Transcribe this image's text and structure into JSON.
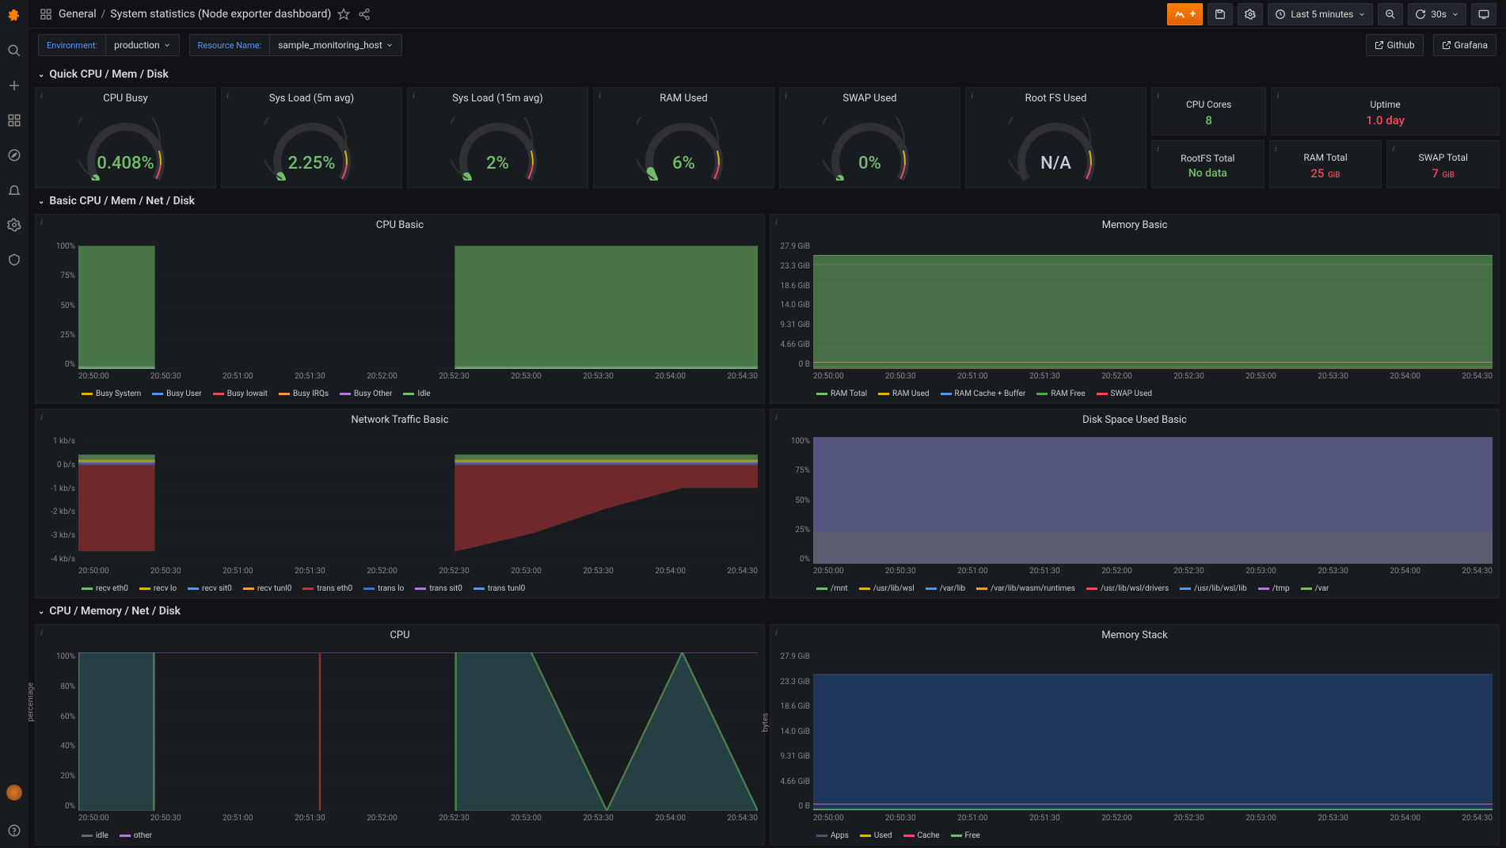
{
  "breadcrumb": {
    "icon": "dashboard-icon",
    "folder": "General",
    "title": "System statistics (Node exporter dashboard)"
  },
  "topbar": {
    "timerange": "Last 5 minutes",
    "refresh": "30s"
  },
  "vars": {
    "env_label": "Environment:",
    "env_value": "production",
    "res_label": "Resource Name:",
    "res_value": "sample_monitoring_host"
  },
  "links": {
    "github": "Github",
    "grafana": "Grafana"
  },
  "rows": {
    "quick": "Quick CPU / Mem / Disk",
    "basic": "Basic CPU / Mem / Net / Disk",
    "full": "CPU / Memory / Net / Disk"
  },
  "gauges": [
    {
      "title": "CPU Busy",
      "value": "0.408%",
      "pct": 0.4
    },
    {
      "title": "Sys Load (5m avg)",
      "value": "2.25%",
      "pct": 2.25
    },
    {
      "title": "Sys Load (15m avg)",
      "value": "2%",
      "pct": 2
    },
    {
      "title": "RAM Used",
      "value": "6%",
      "pct": 6
    },
    {
      "title": "SWAP Used",
      "value": "0%",
      "pct": 0
    },
    {
      "title": "Root FS Used",
      "value": "N/A",
      "pct": null
    }
  ],
  "stats_top": [
    {
      "title": "CPU Cores",
      "value": "8",
      "cls": "green"
    },
    {
      "title": "Uptime",
      "value": "1.0 day",
      "cls": "red"
    }
  ],
  "stats_bot": [
    {
      "title": "RootFS Total",
      "value": "No data",
      "cls": "nodata"
    },
    {
      "title": "RAM Total",
      "value": "25",
      "unit": "GiB",
      "cls": "red"
    },
    {
      "title": "SWAP Total",
      "value": "7",
      "unit": "GiB",
      "cls": "red"
    }
  ],
  "chart_data": [
    {
      "id": "cpu_basic",
      "title": "CPU Basic",
      "type": "area",
      "ylabel": "",
      "ylim": [
        0,
        100
      ],
      "yticks": [
        "0%",
        "25%",
        "50%",
        "75%",
        "100%"
      ],
      "x": [
        "20:50:00",
        "20:50:30",
        "20:51:00",
        "20:51:30",
        "20:52:00",
        "20:52:30",
        "20:53:00",
        "20:53:30",
        "20:54:00",
        "20:54:30"
      ],
      "series": [
        {
          "name": "Busy System",
          "color": "#e0b400",
          "values": [
            1,
            1,
            null,
            null,
            null,
            1,
            1,
            1,
            1,
            1
          ]
        },
        {
          "name": "Busy User",
          "color": "#5794f2",
          "values": [
            2,
            2,
            null,
            null,
            null,
            2,
            2,
            2,
            2,
            2
          ]
        },
        {
          "name": "Busy Iowait",
          "color": "#f2495c",
          "values": [
            0,
            0,
            null,
            null,
            null,
            0,
            0,
            0,
            0,
            0
          ]
        },
        {
          "name": "Busy IRQs",
          "color": "#ff9830",
          "values": [
            0,
            0,
            null,
            null,
            null,
            0,
            0,
            0,
            0,
            0
          ]
        },
        {
          "name": "Busy Other",
          "color": "#b877d9",
          "values": [
            0,
            0,
            null,
            null,
            null,
            0,
            0,
            0,
            0,
            0
          ]
        },
        {
          "name": "Idle",
          "color": "#73bf69",
          "values": [
            97,
            97,
            null,
            null,
            null,
            97,
            97,
            97,
            97,
            97
          ]
        }
      ],
      "stacked": true
    },
    {
      "id": "memory_basic",
      "title": "Memory Basic",
      "type": "area",
      "ylim": [
        0,
        27.9
      ],
      "yticks": [
        "0 B",
        "4.66 GiB",
        "9.31 GiB",
        "14.0 GiB",
        "18.6 GiB",
        "23.3 GiB",
        "27.9 GiB"
      ],
      "x": [
        "20:50:00",
        "20:50:30",
        "20:51:00",
        "20:51:30",
        "20:52:00",
        "20:52:30",
        "20:53:00",
        "20:53:30",
        "20:54:00",
        "20:54:30"
      ],
      "series": [
        {
          "name": "RAM Total",
          "color": "#73bf69",
          "values": [
            25,
            25,
            25,
            25,
            25,
            25,
            25,
            25,
            25,
            25
          ]
        },
        {
          "name": "RAM Used",
          "color": "#e0b400",
          "values": [
            1.5,
            1.5,
            1.5,
            1.5,
            1.5,
            1.5,
            1.5,
            1.5,
            1.5,
            1.5
          ]
        },
        {
          "name": "RAM Cache + Buffer",
          "color": "#5794f2",
          "values": [
            0.5,
            0.5,
            0.5,
            0.5,
            0.5,
            0.5,
            0.5,
            0.5,
            0.5,
            0.5
          ]
        },
        {
          "name": "RAM Free",
          "color": "#56a64b",
          "values": [
            23,
            23,
            23,
            23,
            23,
            23,
            23,
            23,
            23,
            23
          ]
        },
        {
          "name": "SWAP Used",
          "color": "#f2495c",
          "values": [
            0,
            0,
            0,
            0,
            0,
            0,
            0,
            0,
            0,
            0
          ]
        }
      ]
    },
    {
      "id": "net_basic",
      "title": "Network Traffic Basic",
      "type": "area",
      "ylim": [
        -4,
        1
      ],
      "yticks": [
        "-4 kb/s",
        "-3 kb/s",
        "-2 kb/s",
        "-1 kb/s",
        "0 b/s",
        "1 kb/s"
      ],
      "x": [
        "20:50:00",
        "20:50:30",
        "20:51:00",
        "20:51:30",
        "20:52:00",
        "20:52:30",
        "20:53:00",
        "20:53:30",
        "20:54:00",
        "20:54:30"
      ],
      "series": [
        {
          "name": "recv eth0",
          "color": "#73bf69",
          "values": [
            0.3,
            0.3,
            null,
            null,
            null,
            0.3,
            0.3,
            0.3,
            0.3,
            0.3
          ]
        },
        {
          "name": "recv lo",
          "color": "#e0b400",
          "values": [
            0.1,
            0.1,
            null,
            null,
            null,
            0.1,
            0.1,
            0.1,
            0.1,
            0.1
          ]
        },
        {
          "name": "recv sit0",
          "color": "#5794f2",
          "values": [
            0,
            0,
            null,
            null,
            null,
            0,
            0,
            0,
            0,
            0
          ]
        },
        {
          "name": "recv tunl0",
          "color": "#ff9830",
          "values": [
            0,
            0,
            null,
            null,
            null,
            0,
            0,
            0,
            0,
            0
          ]
        },
        {
          "name": "trans eth0",
          "color": "#b83535",
          "values": [
            -3.5,
            -3.5,
            null,
            null,
            null,
            -3.5,
            -2.8,
            -1.8,
            -1,
            -1
          ]
        },
        {
          "name": "trans lo",
          "color": "#3274d9",
          "values": [
            -0.1,
            -0.1,
            null,
            null,
            null,
            -0.1,
            -0.1,
            -0.1,
            -0.1,
            -0.1
          ]
        },
        {
          "name": "trans sit0",
          "color": "#b877d9",
          "values": [
            0,
            0,
            null,
            null,
            null,
            0,
            0,
            0,
            0,
            0
          ]
        },
        {
          "name": "trans tunl0",
          "color": "#5794f2",
          "values": [
            0,
            0,
            null,
            null,
            null,
            0,
            0,
            0,
            0,
            0
          ]
        }
      ]
    },
    {
      "id": "disk_basic",
      "title": "Disk Space Used Basic",
      "type": "area",
      "ylim": [
        0,
        100
      ],
      "yticks": [
        "0%",
        "25%",
        "50%",
        "75%",
        "100%"
      ],
      "x": [
        "20:50:00",
        "20:50:30",
        "20:51:00",
        "20:51:30",
        "20:52:00",
        "20:52:30",
        "20:53:00",
        "20:53:30",
        "20:54:00",
        "20:54:30"
      ],
      "series": [
        {
          "name": "/mnt",
          "color": "#73bf69",
          "values": [
            100,
            100,
            100,
            100,
            100,
            100,
            100,
            100,
            100,
            100
          ]
        },
        {
          "name": "/usr/lib/wsl",
          "color": "#e0b400",
          "values": [
            0,
            0,
            0,
            0,
            0,
            0,
            0,
            0,
            0,
            0
          ]
        },
        {
          "name": "/var/lib",
          "color": "#5794f2",
          "values": [
            0,
            0,
            0,
            0,
            0,
            0,
            0,
            0,
            0,
            0
          ]
        },
        {
          "name": "/var/lib/wasm/runtimes",
          "color": "#ff9830",
          "values": [
            0,
            0,
            0,
            0,
            0,
            0,
            0,
            0,
            0,
            0
          ]
        },
        {
          "name": "/usr/lib/wsl/drivers",
          "color": "#f2495c",
          "values": [
            0,
            0,
            0,
            0,
            0,
            0,
            0,
            0,
            0,
            0
          ]
        },
        {
          "name": "/usr/lib/wsl/lib",
          "color": "#5794f2",
          "values": [
            0,
            0,
            0,
            0,
            0,
            0,
            0,
            0,
            0,
            0
          ]
        },
        {
          "name": "/tmp",
          "color": "#b877d9",
          "values": [
            0,
            0,
            0,
            0,
            0,
            0,
            0,
            0,
            0,
            0
          ]
        },
        {
          "name": "/var",
          "color": "#73bf69",
          "values": [
            0,
            0,
            0,
            0,
            0,
            0,
            0,
            0,
            0,
            0
          ]
        }
      ],
      "fill_two": {
        "top": 100,
        "mid": 25,
        "c1": "#6d6fa8",
        "c2": "#9b9bc4"
      }
    },
    {
      "id": "cpu",
      "title": "CPU",
      "type": "line",
      "ylabel": "percentage",
      "ylim": [
        0,
        100
      ],
      "yticks": [
        "0%",
        "20%",
        "40%",
        "60%",
        "80%",
        "100%"
      ],
      "x": [
        "20:50:00",
        "20:50:30",
        "20:51:00",
        "20:51:30",
        "20:52:00",
        "20:52:30",
        "20:53:00",
        "20:53:30",
        "20:54:00",
        "20:54:30"
      ],
      "series": [
        {
          "name": "idle",
          "color": "#4a7a5a",
          "values": [
            100,
            100,
            0,
            0,
            0,
            100,
            100,
            0,
            100,
            0
          ]
        },
        {
          "name": "other",
          "color": "#b877d9",
          "values": [
            100,
            100,
            100,
            100,
            100,
            100,
            100,
            100,
            100,
            100
          ]
        }
      ],
      "gap": [
        2,
        4
      ]
    },
    {
      "id": "mem_stack",
      "title": "Memory Stack",
      "type": "area",
      "ylabel": "bytes",
      "ylim": [
        0,
        27.9
      ],
      "yticks": [
        "0 B",
        "4.66 GiB",
        "9.31 GiB",
        "14.0 GiB",
        "18.6 GiB",
        "23.3 GiB",
        "27.9 GiB"
      ],
      "x": [
        "20:50:00",
        "20:50:30",
        "20:51:00",
        "20:51:30",
        "20:52:00",
        "20:52:30",
        "20:53:00",
        "20:53:30",
        "20:54:00",
        "20:54:30"
      ],
      "series": [
        {
          "name": "Apps",
          "color": "#3c5a7a",
          "values": [
            24,
            24,
            24,
            24,
            24,
            24,
            24,
            24,
            24,
            24
          ]
        },
        {
          "name": "Used",
          "color": "#e0b400",
          "values": [
            1.2,
            1.2,
            1.2,
            1.2,
            1.2,
            1.2,
            1.2,
            1.2,
            1.2,
            1.2
          ]
        },
        {
          "name": "Cache",
          "color": "#f2495c",
          "values": [
            0.3,
            0.3,
            0.3,
            0.3,
            0.3,
            0.3,
            0.3,
            0.3,
            0.3,
            0.3
          ]
        },
        {
          "name": "Free",
          "color": "#73bf69",
          "values": [
            0.2,
            0.2,
            0.2,
            0.2,
            0.2,
            0.2,
            0.2,
            0.2,
            0.2,
            0.2
          ]
        }
      ]
    }
  ]
}
